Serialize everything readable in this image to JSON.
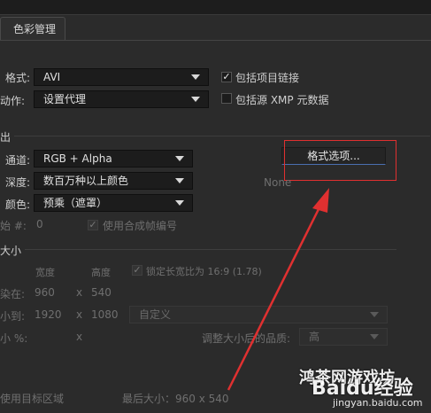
{
  "tab": {
    "label": "色彩管理"
  },
  "format": {
    "label": "格式:",
    "value": "AVI"
  },
  "post_action": {
    "label": "动作:",
    "value": "设置代理"
  },
  "include_project_link": {
    "label": "包括项目链接",
    "checked": true
  },
  "include_xmp": {
    "label": "包括源 XMP 元数据",
    "checked": false
  },
  "output_section": {
    "title": "出"
  },
  "channels": {
    "label": "通道:",
    "value": "RGB + Alpha"
  },
  "depth": {
    "label": "深度:",
    "value": "数百万种以上颜色"
  },
  "color": {
    "label": "颜色:",
    "value": "预乘（遮罩）"
  },
  "start": {
    "label": "始 #:",
    "value": "0"
  },
  "use_comp_frame": {
    "label": "使用合成帧编号",
    "checked": true
  },
  "format_options_button": {
    "label": "格式选项..."
  },
  "format_options_summary": "None",
  "resize_section": {
    "title": "大小",
    "width_header": "宽度",
    "height_header": "高度",
    "lock_label": "锁定长宽比为 16:9 (1.78)",
    "rendering_label": "染在:",
    "rendering_w": "960",
    "rendering_x": "x",
    "rendering_h": "540",
    "resize_to_label": "小到:",
    "resize_w": "1920",
    "resize_x": "x",
    "resize_h": "1080",
    "preset_value": "自定义",
    "percent_label": "小 %:",
    "percent_x": "x",
    "quality_label": "调整大小后的品质:",
    "quality_value": "高"
  },
  "crop": {
    "label": "使用目标区域",
    "final_size": "最后大小：960 x 540"
  },
  "watermark": {
    "text": "Baidu经验",
    "site_text": "jingyan.baidu.com",
    "overlay_text": "鸿茶网游戏坊"
  },
  "colors": {
    "annotation": "#e03030",
    "focus": "#4a6fb0"
  }
}
